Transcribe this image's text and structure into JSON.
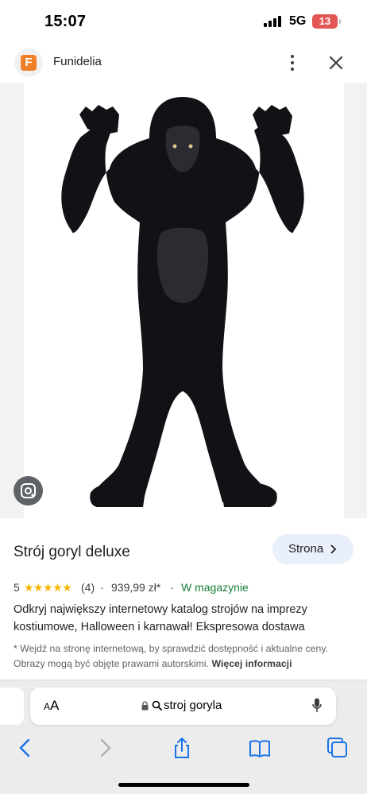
{
  "status_bar": {
    "time": "15:07",
    "network": "5G",
    "battery": "13"
  },
  "header": {
    "site_name": "Funidelia",
    "logo_letter": "F",
    "brand_color": "#f07f2a"
  },
  "image": {
    "subject": "gorilla-costume-image"
  },
  "product": {
    "title": "Strój goryl deluxe",
    "site_button_label": "Strona",
    "rating_value": "5",
    "stars": "★★★★★",
    "review_count": "(4)",
    "price": "939,99 zł*",
    "availability": "W magazynie",
    "separator": "·",
    "description": "Odkryj największy internetowy katalog strojów na imprezy kostiumowe, Halloween i karnawał! Ekspresowa dostawa",
    "disclaimer": "* Wejdź na stronę internetową, by sprawdzić dostępność i aktualne ceny. Obrazy mogą być objęte prawami autorskimi.",
    "more_info_label": "Więcej informacji"
  },
  "browser": {
    "aa_small": "A",
    "aa_large": "A",
    "url": "stroj goryla",
    "toolbar_icons": [
      "back-icon",
      "forward-icon",
      "share-icon",
      "bookmarks-icon",
      "tabs-icon"
    ]
  },
  "colors": {
    "accent_blue": "#1a73e8",
    "stock_green": "#188038",
    "star_yellow": "#f5b400",
    "site_button_bg": "#e9effb"
  }
}
